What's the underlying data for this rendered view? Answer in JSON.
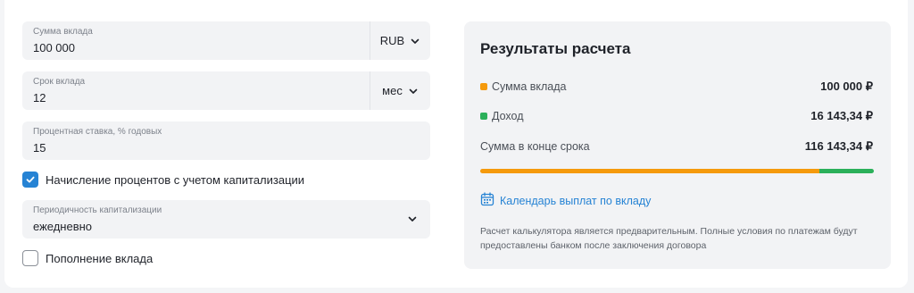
{
  "form": {
    "amount": {
      "label": "Сумма вклада",
      "value": "100 000",
      "unit": "RUB"
    },
    "term": {
      "label": "Срок вклада",
      "value": "12",
      "unit": "мес"
    },
    "rate": {
      "label": "Процентная ставка, % годовых",
      "value": "15"
    },
    "capitalization_checkbox": {
      "label": "Начисление процентов с учетом капитализации",
      "checked": true
    },
    "periodicity": {
      "label": "Периодичность капитализации",
      "value": "ежедневно"
    },
    "replenishment_checkbox": {
      "label": "Пополнение вклада",
      "checked": false
    }
  },
  "results": {
    "title": "Результаты расчета",
    "rows": [
      {
        "label": "Сумма вклада",
        "value": "100 000 ₽",
        "color": "#f59a0c"
      },
      {
        "label": "Доход",
        "value": "16 143,34 ₽",
        "color": "#2bb05a"
      },
      {
        "label": "Сумма в конце срока",
        "value": "116 143,34 ₽"
      }
    ],
    "progress": {
      "principal": 100000,
      "income": 16143.34
    },
    "calendar_link": "Календарь выплат по вкладу",
    "note": "Расчет калькулятора является предварительным. Полные условия по платежам будут предоставлены банком после заключения договора"
  },
  "colors": {
    "accent": "#2683d4",
    "principal": "#f59a0c",
    "income": "#2bb05a"
  }
}
